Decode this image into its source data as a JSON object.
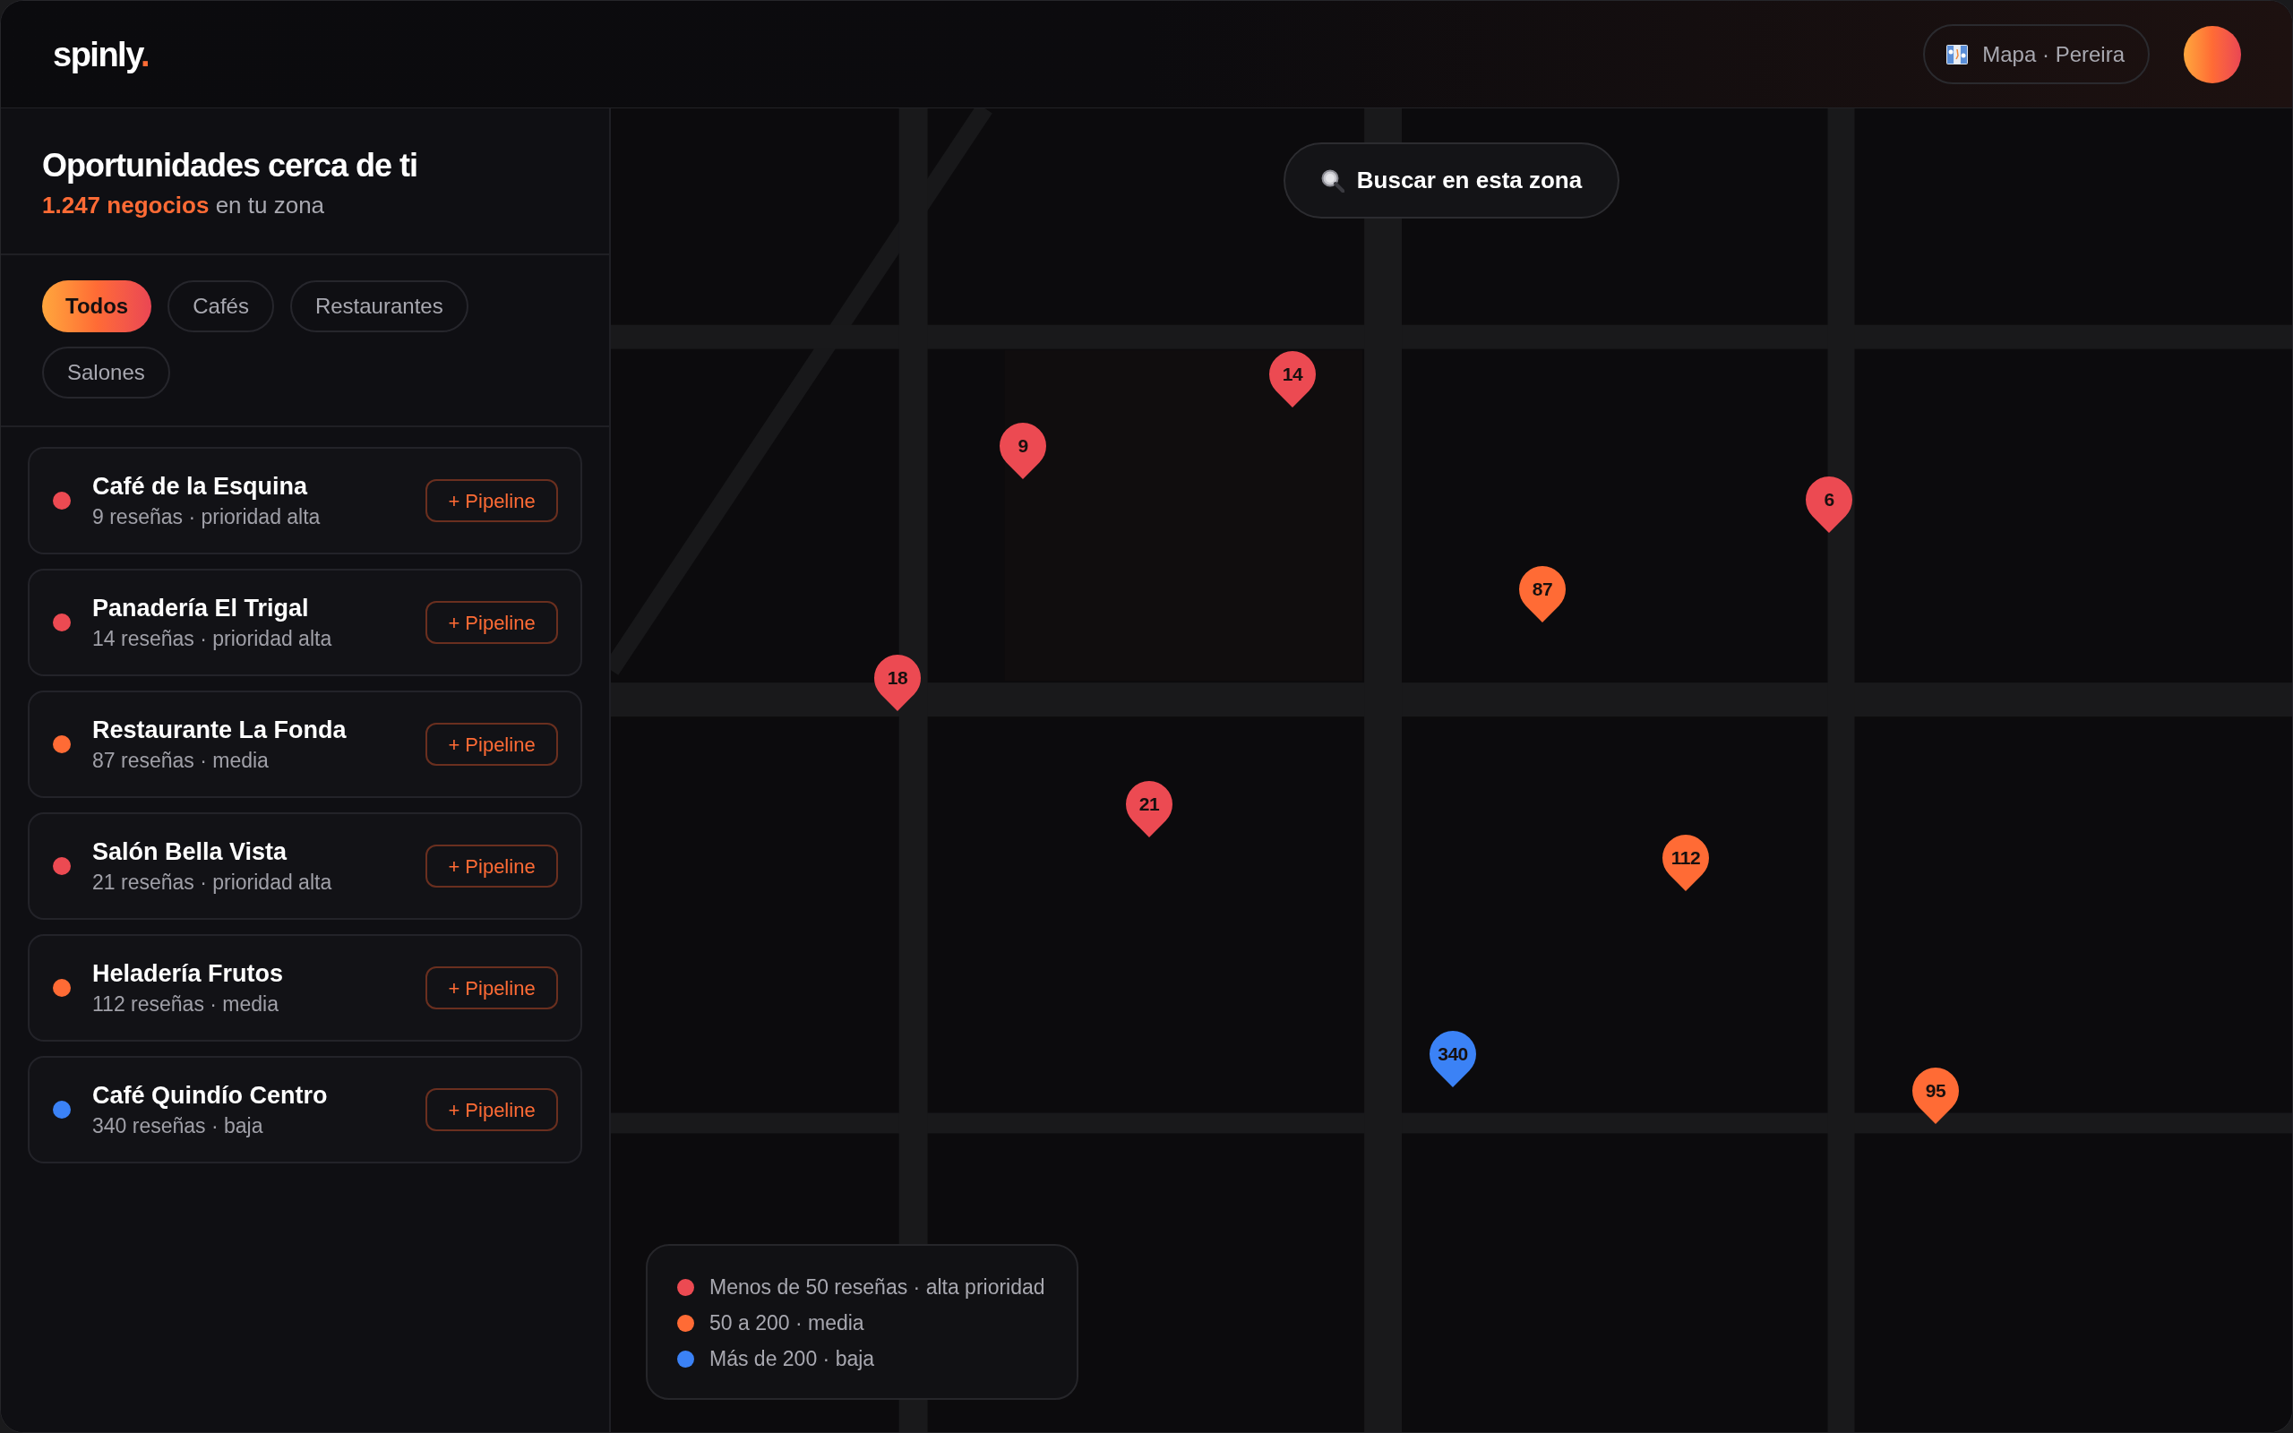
{
  "header": {
    "logo": {
      "text": "spinly",
      "mark": "."
    },
    "location_chip": "Mapa · Pereira"
  },
  "sidebar": {
    "title": "Oportunidades cerca de ti",
    "subtitle": "**1.247 negocios** en tu zona",
    "filters": [
      {
        "label": "Todos",
        "selected": true
      },
      {
        "label": "Cafés",
        "selected": false
      },
      {
        "label": "Restaurantes",
        "selected": false
      },
      {
        "label": "Salones",
        "selected": false
      }
    ],
    "businesses": [
      {
        "name": "Café de la Esquina",
        "meta": "9 reseñas · prioridad alta",
        "color": "#ec4a52",
        "action": "+ Pipeline"
      },
      {
        "name": "Panadería El Trigal",
        "meta": "14 reseñas · prioridad alta",
        "color": "#ec4a52",
        "action": "+ Pipeline"
      },
      {
        "name": "Restaurante La Fonda",
        "meta": "87 reseñas · media",
        "color": "#ff6b35",
        "action": "+ Pipeline"
      },
      {
        "name": "Salón Bella Vista",
        "meta": "21 reseñas · prioridad alta",
        "color": "#ec4a52",
        "action": "+ Pipeline"
      },
      {
        "name": "Heladería Frutos",
        "meta": "112 reseñas · media",
        "color": "#ff6b35",
        "action": "+ Pipeline"
      },
      {
        "name": "Café Quindío Centro",
        "meta": "340 reseñas · baja",
        "color": "#3b82f6",
        "action": "+ Pipeline"
      }
    ]
  },
  "map": {
    "search_button": "Buscar en esta zona",
    "pins": [
      {
        "label": "14",
        "color": "#ec4a52"
      },
      {
        "label": "9",
        "color": "#ec4a52"
      },
      {
        "label": "6",
        "color": "#ec4a52"
      },
      {
        "label": "87",
        "color": "#ff6b35"
      },
      {
        "label": "18",
        "color": "#ec4a52"
      },
      {
        "label": "21",
        "color": "#ec4a52"
      },
      {
        "label": "112",
        "color": "#ff6b35"
      },
      {
        "label": "340",
        "color": "#3b82f6"
      },
      {
        "label": "95",
        "color": "#ff6b35"
      }
    ],
    "legend": [
      {
        "label": "Menos de 50 reseñas · alta prioridad",
        "color": "#ec4a52"
      },
      {
        "label": "50 a 200 · media",
        "color": "#ff6b35"
      },
      {
        "label": "Más de 200 · baja",
        "color": "#3b82f6"
      }
    ]
  }
}
